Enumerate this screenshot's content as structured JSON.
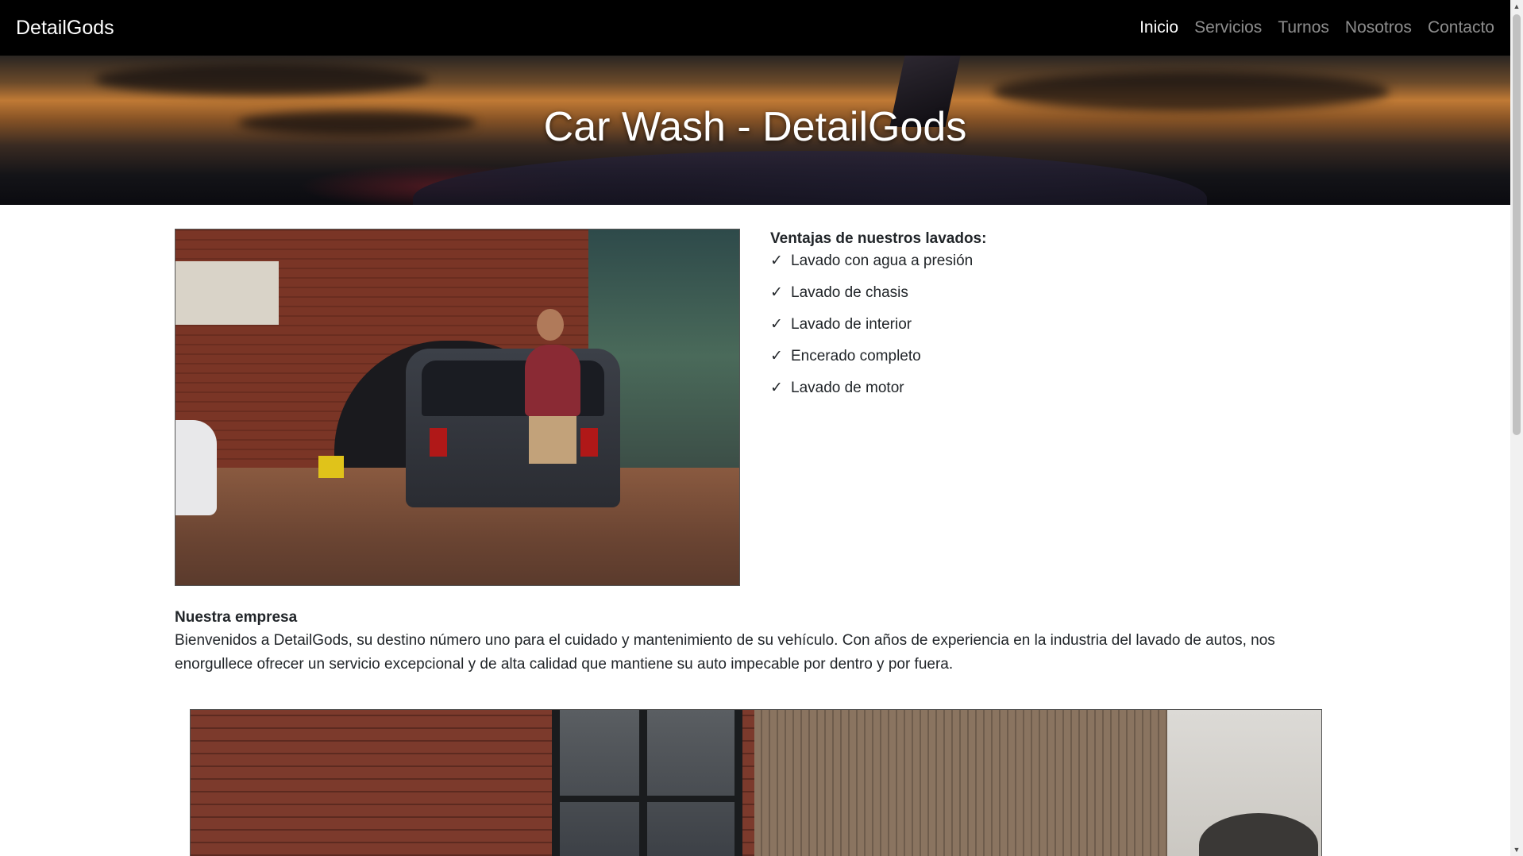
{
  "navbar": {
    "brand": "DetailGods",
    "links": [
      {
        "label": "Inicio",
        "active": true
      },
      {
        "label": "Servicios",
        "active": false
      },
      {
        "label": "Turnos",
        "active": false
      },
      {
        "label": "Nosotros",
        "active": false
      },
      {
        "label": "Contacto",
        "active": false
      }
    ]
  },
  "hero": {
    "title": "Car Wash - DetailGods"
  },
  "benefits": {
    "title": "Ventajas de nuestros lavados:",
    "check_icon": "✓",
    "items": [
      "Lavado con agua a presión",
      "Lavado de chasis",
      "Lavado de interior",
      "Encerado completo",
      "Lavado de motor"
    ]
  },
  "about": {
    "title": "Nuestra empresa",
    "text": "Bienvenidos a DetailGods, su destino número uno para el cuidado y mantenimiento de su vehículo. Con años de experiencia en la industria del lavado de autos, nos enorgullece ofrecer un servicio excepcional y de alta calidad que mantiene su auto impecable por dentro y por fuera."
  },
  "scrollbar": {
    "up_icon": "▲",
    "down_icon": "▼"
  },
  "colors": {
    "navbar_bg": "#000000",
    "nav_active": "#ffffff",
    "nav_inactive": "rgba(255,255,255,0.55)",
    "text": "#212529"
  }
}
